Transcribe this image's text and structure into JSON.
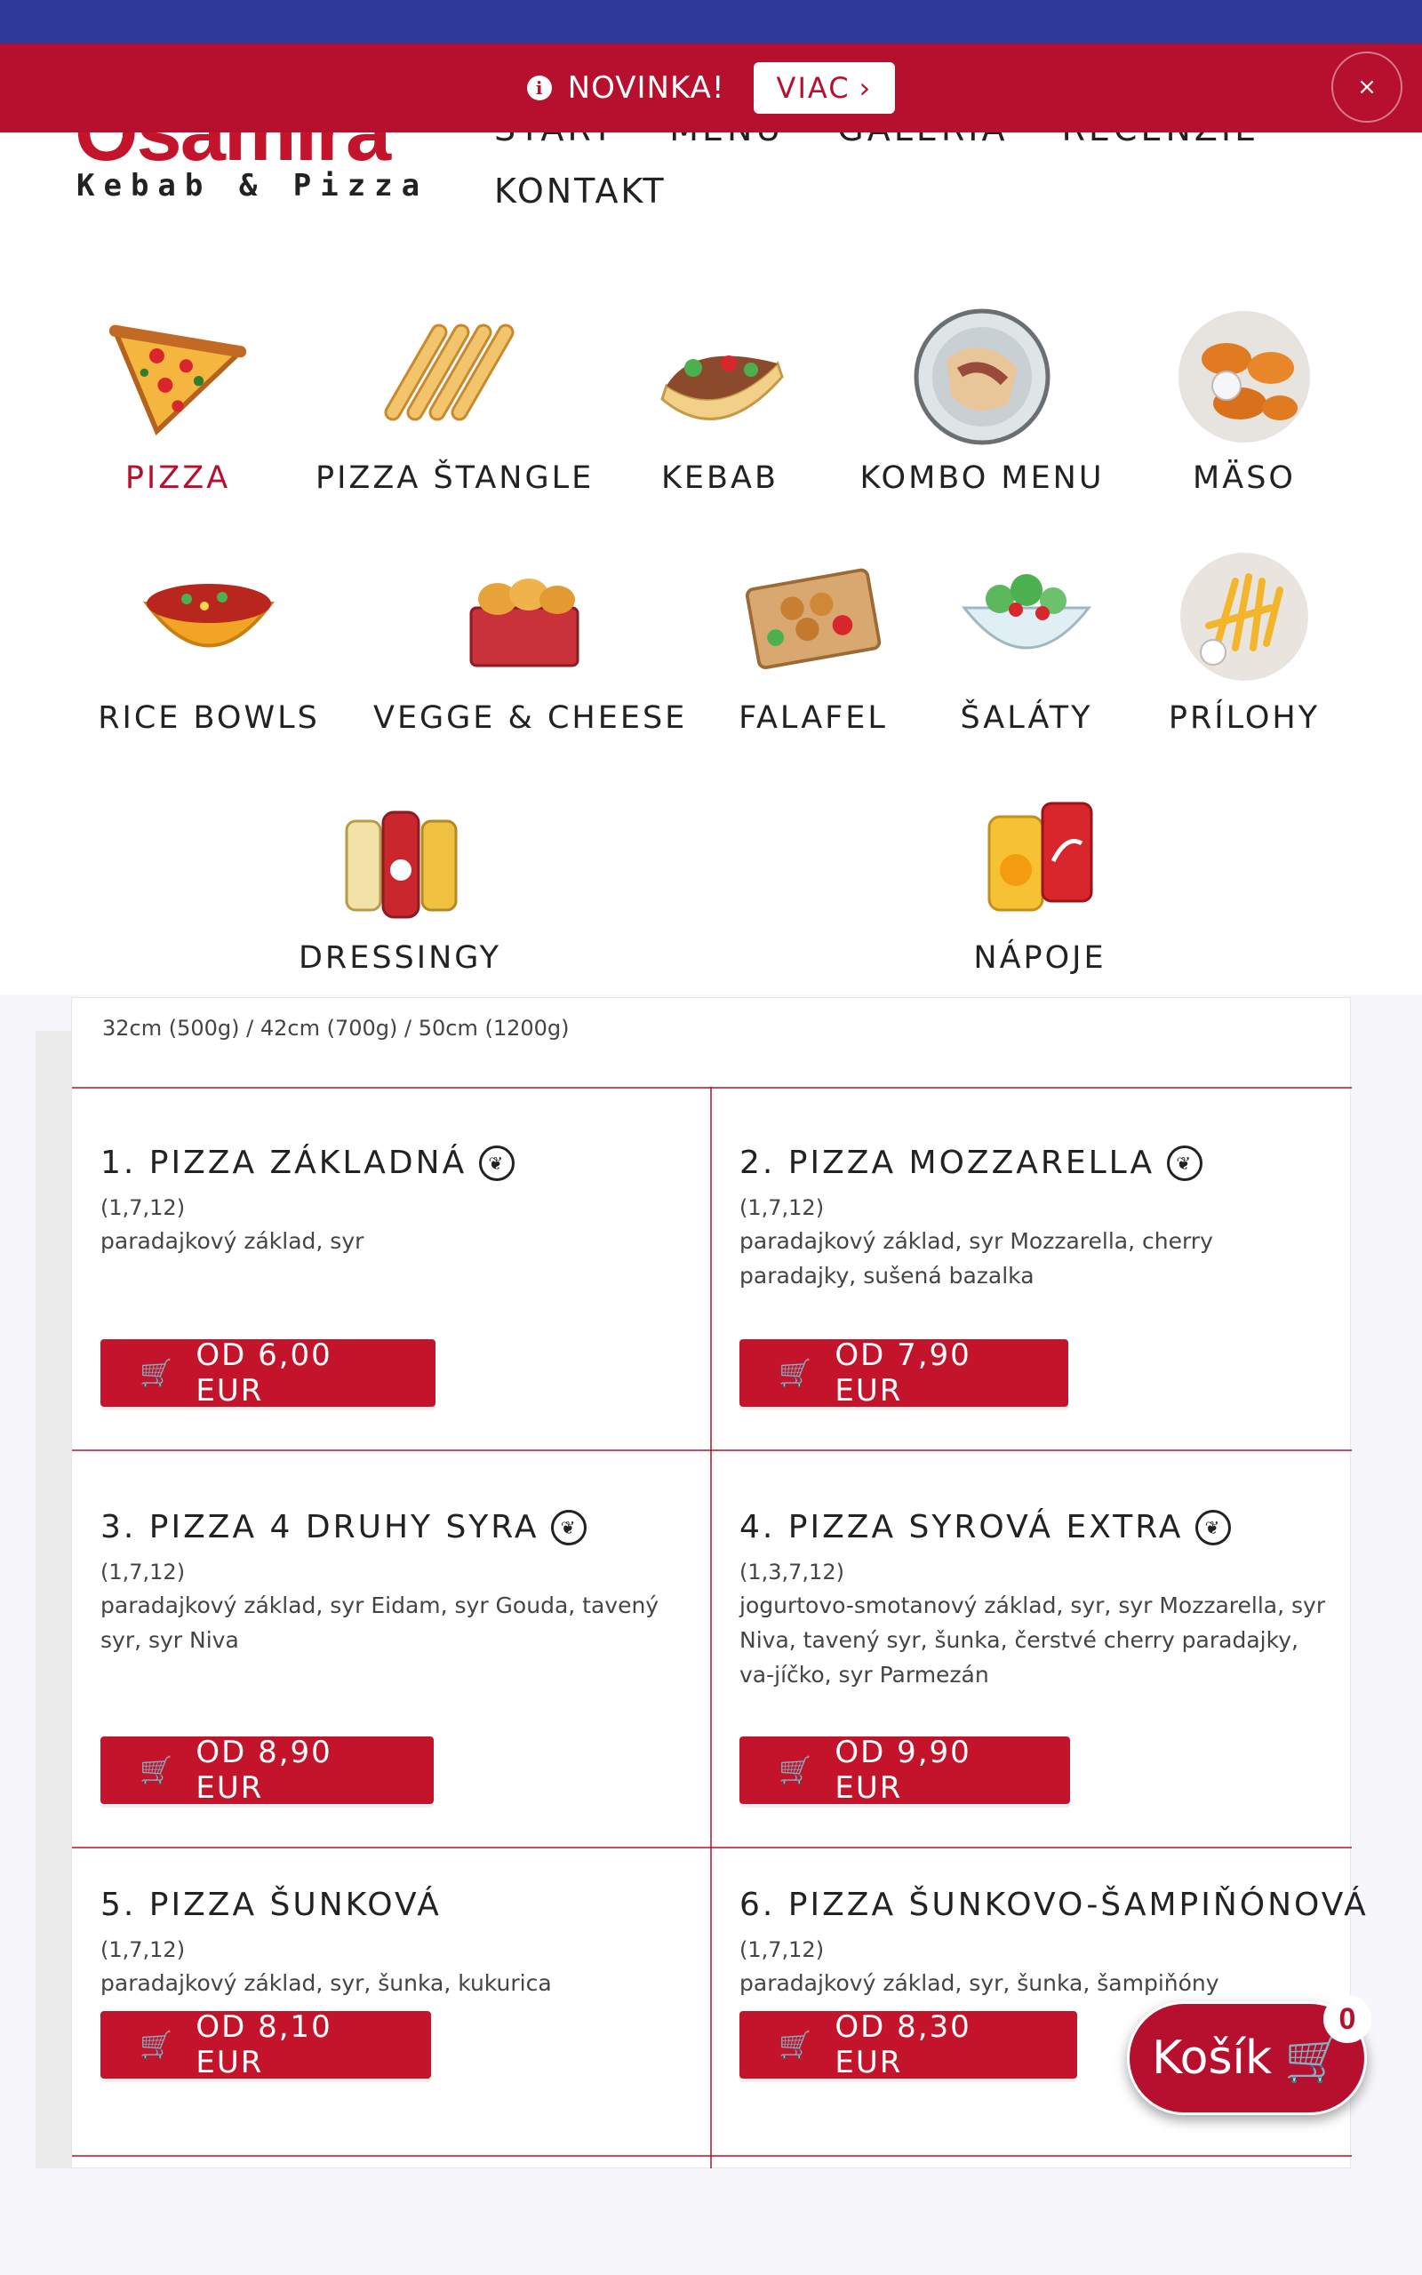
{
  "promo": {
    "label": "NOVINKA!",
    "button_label": "VIAC",
    "close_label": "×"
  },
  "header": {
    "logo_text": "Osamira",
    "logo_sub": "Kebab & Pizza",
    "nav": [
      "START",
      "MENU",
      "GALÉRIA",
      "RECENZIE"
    ],
    "kontakt": "KONTAKT"
  },
  "categories": [
    {
      "label": "PIZZA",
      "icon": "pizza-icon",
      "active": true
    },
    {
      "label": "PIZZA ŠTANGLE",
      "icon": "breadsticks-icon"
    },
    {
      "label": "KEBAB",
      "icon": "kebab-icon"
    },
    {
      "label": "KOMBO MENU",
      "icon": "combo-icon"
    },
    {
      "label": "MÄSO",
      "icon": "meat-icon"
    },
    {
      "label": "RICE BOWLS",
      "icon": "bowl-icon"
    },
    {
      "label": "VEGGE & CHEESE",
      "icon": "cheese-icon"
    },
    {
      "label": "FALAFEL",
      "icon": "falafel-icon"
    },
    {
      "label": "ŠALÁTY",
      "icon": "salad-icon"
    },
    {
      "label": "PRÍLOHY",
      "icon": "fries-icon"
    },
    {
      "label": "DRESSINGY",
      "icon": "dressing-icon"
    },
    {
      "label": "NÁPOJE",
      "icon": "drink-icon"
    }
  ],
  "menu": {
    "size_note": "32cm (500g) / 42cm (700g) / 50cm (1200g)",
    "items": [
      {
        "title": "1. PIZZA ZÁKLADNÁ",
        "veg": true,
        "allergens": "(1,7,12)",
        "desc": "paradajkový základ, syr",
        "price": "OD 6,00 EUR"
      },
      {
        "title": "2. PIZZA MOZZARELLA",
        "veg": true,
        "allergens": "(1,7,12)",
        "desc": "paradajkový základ, syr Mozzarella, cherry paradajky, sušená bazalka",
        "price": "OD 7,90 EUR"
      },
      {
        "title": "3. PIZZA 4 DRUHY SYRA",
        "veg": true,
        "allergens": "(1,7,12)",
        "desc": "paradajkový základ, syr Eidam, syr Gouda, tavený syr, syr Niva",
        "price": "OD 8,90 EUR"
      },
      {
        "title": "4. PIZZA SYROVÁ EXTRA",
        "veg": true,
        "allergens": "(1,3,7,12)",
        "desc": "jogurtovo-smotanový základ, syr, syr Mozzarella, syr Niva, tavený syr, šunka, čerstvé cherry paradajky, va-jíčko, syr Parmezán",
        "price": "OD 9,90 EUR"
      },
      {
        "title": "5. PIZZA ŠUNKOVÁ",
        "veg": false,
        "allergens": "(1,7,12)",
        "desc": "paradajkový základ, syr, šunka, kukurica",
        "price": "OD 8,10 EUR"
      },
      {
        "title": "6. PIZZA ŠUNKOVO-ŠAMPIŇÓNOVÁ",
        "veg": false,
        "allergens": "(1,7,12)",
        "desc": "paradajkový základ, syr, šunka, šampiňóny",
        "price": "OD 8,30 EUR"
      }
    ]
  },
  "cart": {
    "label": "Košík",
    "count": "0"
  },
  "colors": {
    "accent": "#b70f2e",
    "top_strip": "#2f3a98"
  }
}
